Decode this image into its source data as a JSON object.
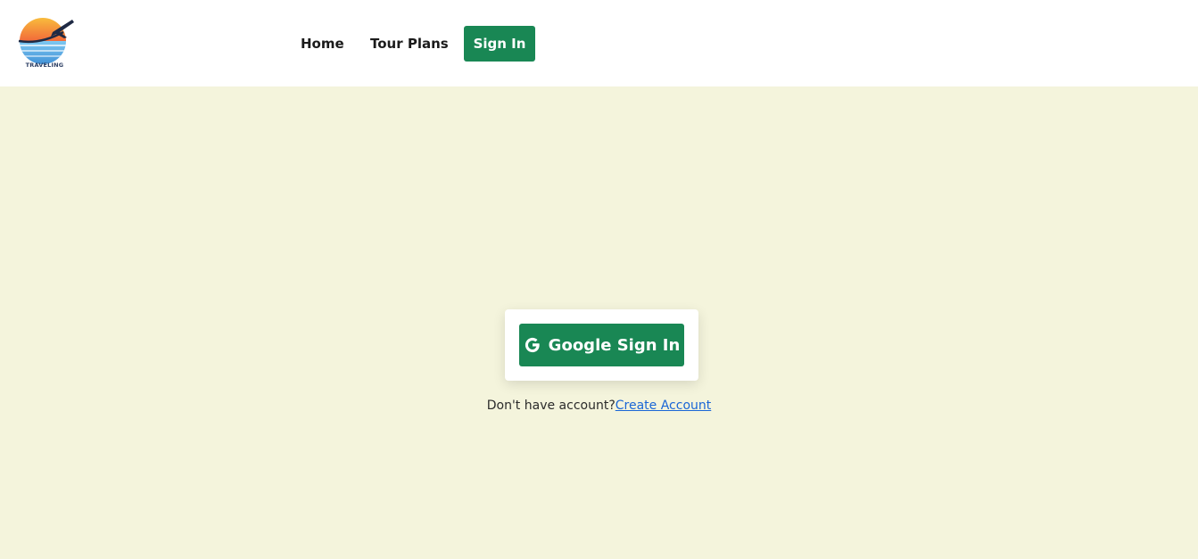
{
  "header": {
    "logo": {
      "text": "TRAVELING",
      "icon": "airplane-sunset-logo"
    },
    "nav": {
      "home_label": "Home",
      "tour_plans_label": "Tour Plans",
      "sign_in_label": "Sign In"
    }
  },
  "signin_card": {
    "google_button_label": "Google Sign In",
    "google_icon": "google-icon"
  },
  "account_prompt": {
    "text": "Don't have account?",
    "link_label": "Create Account"
  },
  "colors": {
    "brand_green": "#198754",
    "page_background": "#f4f4dc",
    "link_blue": "#1a66d6"
  }
}
